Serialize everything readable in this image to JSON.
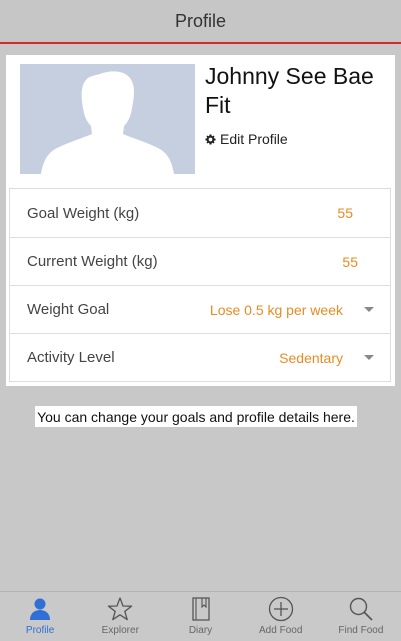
{
  "header": {
    "title": "Profile"
  },
  "profile": {
    "name": "Johnny See Bae Fit",
    "edit_label": "Edit Profile"
  },
  "settings": [
    {
      "label": "Goal Weight (kg)",
      "value": "55"
    },
    {
      "label": "Current Weight (kg)",
      "value": "55"
    },
    {
      "label": "Weight Goal",
      "value": "Lose 0.5 kg per week"
    },
    {
      "label": "Activity Level",
      "value": "Sedentary"
    }
  ],
  "hint": "You can change your goals and profile details here.",
  "tabs": [
    {
      "label": "Profile",
      "icon": "person-icon",
      "active": true
    },
    {
      "label": "Explorer",
      "icon": "star-icon",
      "active": false
    },
    {
      "label": "Diary",
      "icon": "book-icon",
      "active": false
    },
    {
      "label": "Add Food",
      "icon": "plus-circle-icon",
      "active": false
    },
    {
      "label": "Find Food",
      "icon": "search-icon",
      "active": false
    }
  ],
  "colors": {
    "accent": "#e78c22",
    "header_border": "#d22a2a",
    "active_tab": "#2f6fd6",
    "avatar_bg": "#c5cfe0"
  }
}
